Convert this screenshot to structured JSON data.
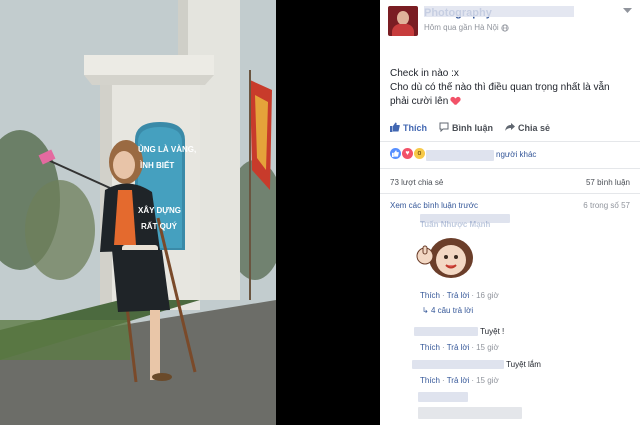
{
  "post": {
    "page_name": "Photography",
    "meta": "Hôm qua gần Hà Nội",
    "text_line1": "Check in nào :x",
    "text_line2": "Cho dù có thế nào thì điều quan trọng nhất là vẫn",
    "text_line3": "phải cười lên"
  },
  "actions": {
    "like": "Thích",
    "comment": "Bình luận",
    "share": "Chia sẻ"
  },
  "stats": {
    "others": "người khác",
    "shares": "73 lượt chia sẻ",
    "comments": "57 bình luận",
    "previous": "Xem các bình luận trước",
    "page": "6 trong số 57"
  },
  "comments": [
    {
      "name": "Tuấn Nhược Mạnh",
      "text": "",
      "like": "Thích",
      "reply": "Trả lời",
      "time": "16 giờ"
    },
    {
      "name": "",
      "text": "Tuyệt !",
      "like": "Thích",
      "reply": "Trả lời",
      "time": "15 giờ"
    },
    {
      "name": "",
      "text": "Tuyệt lắm",
      "like": "Thích",
      "reply": "Trả lời",
      "time": "15 giờ"
    }
  ],
  "replies": "4 câu trả lời",
  "sign": {
    "line1": "ỦNG LÀ VÀNG,",
    "line2": "ÌNH BIẾT",
    "line3": "XÂY DỰNG",
    "line4": "RẤT QUÝ"
  },
  "colors": {
    "fb_blue": "#4267b2",
    "link_blue": "#365899",
    "muted": "#90949c",
    "love": "#f25268"
  },
  "icons": [
    "like-icon",
    "comment-icon",
    "share-icon",
    "globe-icon",
    "chevron-down-icon",
    "heart-icon",
    "reply-arrow-icon"
  ]
}
